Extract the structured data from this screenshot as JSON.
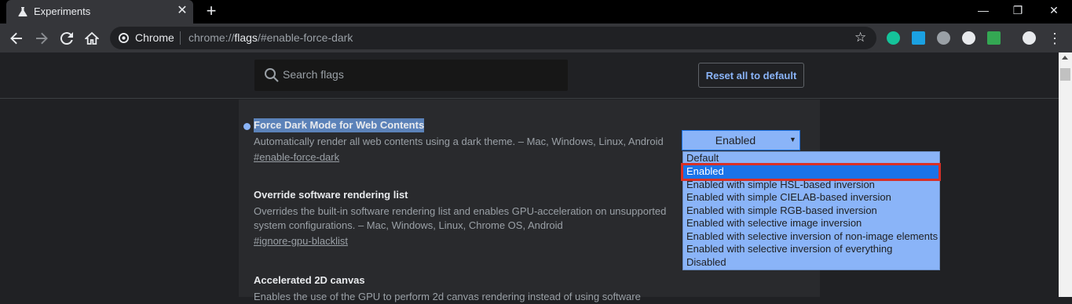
{
  "tab": {
    "title": "Experiments",
    "close": "✕"
  },
  "newtab": "+",
  "window": {
    "minimize": "—",
    "restore": "❐",
    "close": "✕"
  },
  "omnibox": {
    "site": "Chrome",
    "url_prefix": "chrome://",
    "url_bold": "flags",
    "url_suffix": "/#enable-force-dark"
  },
  "search": {
    "placeholder": "Search flags"
  },
  "reset_label": "Reset all to default",
  "flags": [
    {
      "title": "Force Dark Mode for Web Contents",
      "desc": "Automatically render all web contents using a dark theme. – Mac, Windows, Linux, Android",
      "link": "#enable-force-dark"
    },
    {
      "title": "Override software rendering list",
      "desc": "Overrides the built-in software rendering list and enables GPU-acceleration on unsupported system configurations. – Mac, Windows, Linux, Chrome OS, Android",
      "link": "#ignore-gpu-blacklist"
    },
    {
      "title": "Accelerated 2D canvas",
      "desc": "Enables the use of the GPU to perform 2d canvas rendering instead of using software"
    }
  ],
  "select": {
    "value": "Enabled"
  },
  "dropdown": {
    "options": [
      "Default",
      "Enabled",
      "Enabled with simple HSL-based inversion",
      "Enabled with simple CIELAB-based inversion",
      "Enabled with simple RGB-based inversion",
      "Enabled with selective image inversion",
      "Enabled with selective inversion of non-image elements",
      "Enabled with selective inversion of everything",
      "Disabled"
    ],
    "selected_index": 1
  },
  "colors": {
    "accent": "#8ab4f8",
    "highlight": "#d93025",
    "selected": "#1a73e8"
  }
}
